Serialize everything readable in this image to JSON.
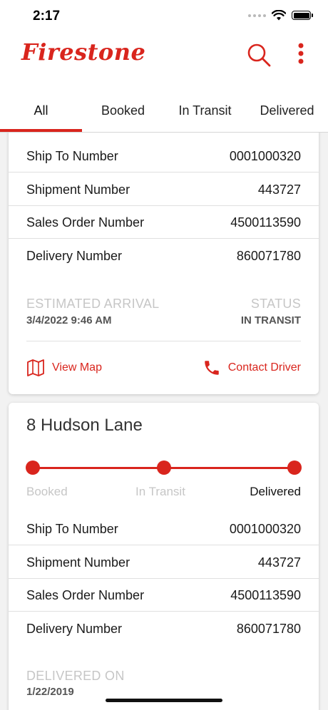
{
  "status_bar": {
    "time": "2:17"
  },
  "header": {
    "brand": "Firestone"
  },
  "tabs": [
    {
      "label": "All"
    },
    {
      "label": "Booked"
    },
    {
      "label": "In Transit"
    },
    {
      "label": "Delivered"
    }
  ],
  "card1": {
    "rows": [
      {
        "label": "Ship To Number",
        "value": "0001000320"
      },
      {
        "label": "Shipment Number",
        "value": "443727"
      },
      {
        "label": "Sales Order Number",
        "value": "4500113590"
      },
      {
        "label": "Delivery Number",
        "value": "860071780"
      }
    ],
    "eta_label": "ESTIMATED ARRIVAL",
    "eta_value": "3/4/2022 9:46 AM",
    "status_label": "STATUS",
    "status_value": "IN TRANSIT",
    "view_map": "View Map",
    "contact_driver": "Contact Driver"
  },
  "card2": {
    "title": "8 Hudson Lane",
    "steps": [
      "Booked",
      "In Transit",
      "Delivered"
    ],
    "rows": [
      {
        "label": "Ship To Number",
        "value": "0001000320"
      },
      {
        "label": "Shipment Number",
        "value": "443727"
      },
      {
        "label": "Sales Order Number",
        "value": "4500113590"
      },
      {
        "label": "Delivery Number",
        "value": "860071780"
      }
    ],
    "delivered_label": "DELIVERED ON",
    "delivered_value": "1/22/2019"
  },
  "colors": {
    "accent": "#d9251d"
  }
}
